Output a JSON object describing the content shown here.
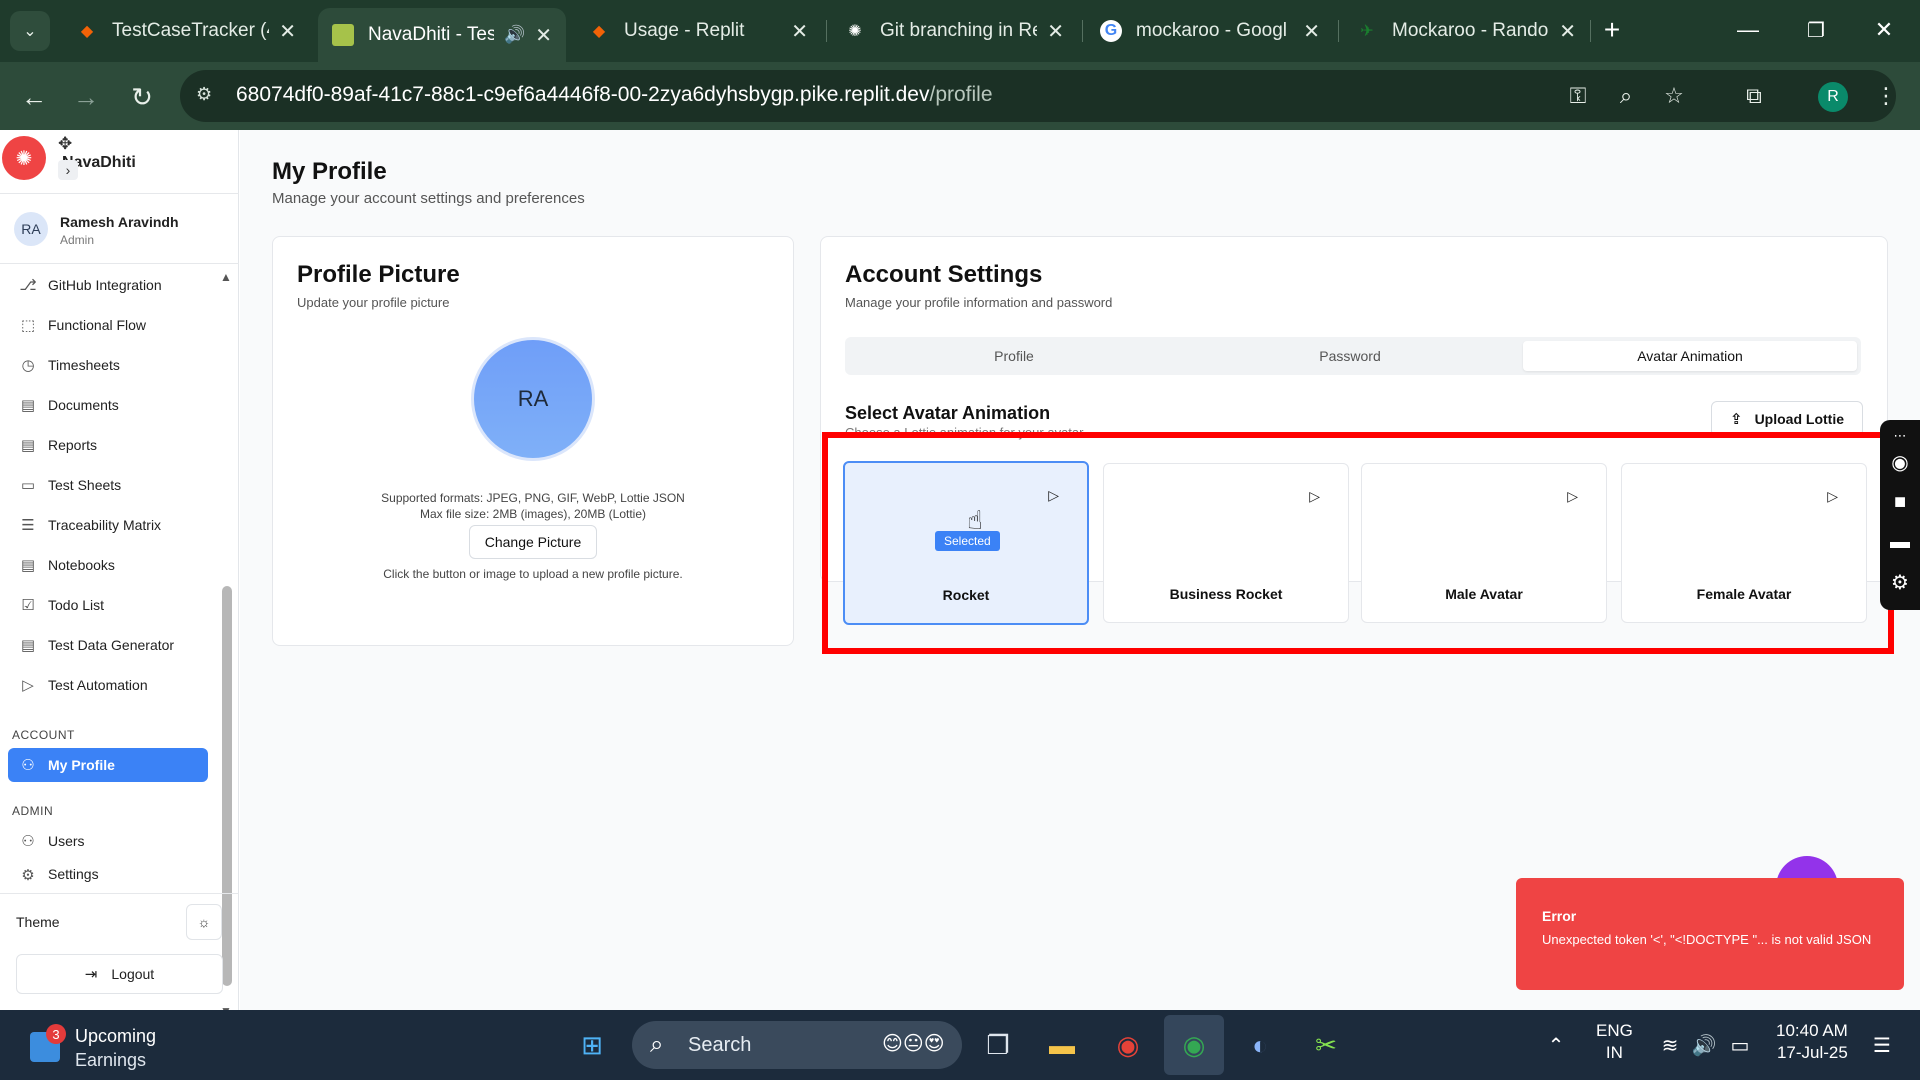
{
  "browser": {
    "tabs": [
      {
        "title": "TestCaseTracker (4)",
        "icon": "replit-icon",
        "color": "#f26207"
      },
      {
        "title": "NavaDhiti - Tes",
        "icon": "navadhiti-favicon",
        "color": "#a6c24a"
      },
      {
        "title": "Usage - Replit",
        "icon": "replit-icon",
        "color": "#f26207"
      },
      {
        "title": "Git branching in Re",
        "icon": "openai-icon",
        "color": "#ffffff"
      },
      {
        "title": "mockaroo - Googl",
        "icon": "google-icon",
        "color": "#4285f4"
      },
      {
        "title": "Mockaroo - Rando",
        "icon": "mockaroo-icon",
        "color": "#1a7f2e"
      }
    ],
    "url_host": "68074df0-89af-41c7-88c1-c9ef6a4446f8-00-2zya6dyhsbygp.pike.replit.dev",
    "url_path": "/profile",
    "profile_initial": "R"
  },
  "sidebar": {
    "brand": "NavaDhiti",
    "user": {
      "initials": "RA",
      "name": "Ramesh Aravindh",
      "role": "Admin"
    },
    "items": [
      {
        "label": "GitHub Integration",
        "icon": "github-icon"
      },
      {
        "label": "Functional Flow",
        "icon": "flow-icon"
      },
      {
        "label": "Timesheets",
        "icon": "clock-icon"
      },
      {
        "label": "Documents",
        "icon": "document-icon"
      },
      {
        "label": "Reports",
        "icon": "report-icon"
      },
      {
        "label": "Test Sheets",
        "icon": "sheet-icon"
      },
      {
        "label": "Traceability Matrix",
        "icon": "filter-icon"
      },
      {
        "label": "Notebooks",
        "icon": "notebook-icon"
      },
      {
        "label": "Todo List",
        "icon": "checkbox-icon"
      },
      {
        "label": "Test Data Generator",
        "icon": "document-icon"
      },
      {
        "label": "Test Automation",
        "icon": "play-icon"
      }
    ],
    "account_label": "ACCOUNT",
    "my_profile": "My Profile",
    "admin_label": "ADMIN",
    "users": "Users",
    "settings": "Settings",
    "theme_label": "Theme",
    "logout": "Logout"
  },
  "main": {
    "title": "My Profile",
    "subtitle": "Manage your account settings and preferences",
    "picture_card": {
      "title": "Profile Picture",
      "subtitle": "Update your profile picture",
      "initials": "RA",
      "formats": "Supported formats: JPEG, PNG, GIF, WebP, Lottie JSON",
      "max_size": "Max file size: 2MB (images), 20MB (Lottie)",
      "button": "Change Picture",
      "hint": "Click the button or image to upload a new profile picture."
    },
    "settings_card": {
      "title": "Account Settings",
      "subtitle": "Manage your profile information and password",
      "tabs": [
        "Profile",
        "Password",
        "Avatar Animation"
      ],
      "active_tab": "Avatar Animation",
      "select_title": "Select Avatar Animation",
      "select_subtitle": "Choose a Lottie animation for your avatar",
      "upload_button": "Upload Lottie",
      "animations": [
        {
          "name": "Rocket",
          "selected": true
        },
        {
          "name": "Business Rocket",
          "selected": false
        },
        {
          "name": "Male Avatar",
          "selected": false
        },
        {
          "name": "Female Avatar",
          "selected": false
        }
      ],
      "selected_badge": "Selected"
    },
    "toast": {
      "title": "Error",
      "message": "Unexpected token '<', \"<!DOCTYPE \"... is not valid JSON"
    }
  },
  "taskbar": {
    "weather_badge": "3",
    "weather_line1": "Upcoming",
    "weather_line2": "Earnings",
    "search": "Search",
    "lang1": "ENG",
    "lang2": "IN",
    "time": "10:40 AM",
    "date": "17-Jul-25"
  },
  "colors": {
    "accent": "#3b82f6",
    "error": "#ef4444",
    "highlight": "#ff0000",
    "chrome": "#2d4b3a"
  }
}
